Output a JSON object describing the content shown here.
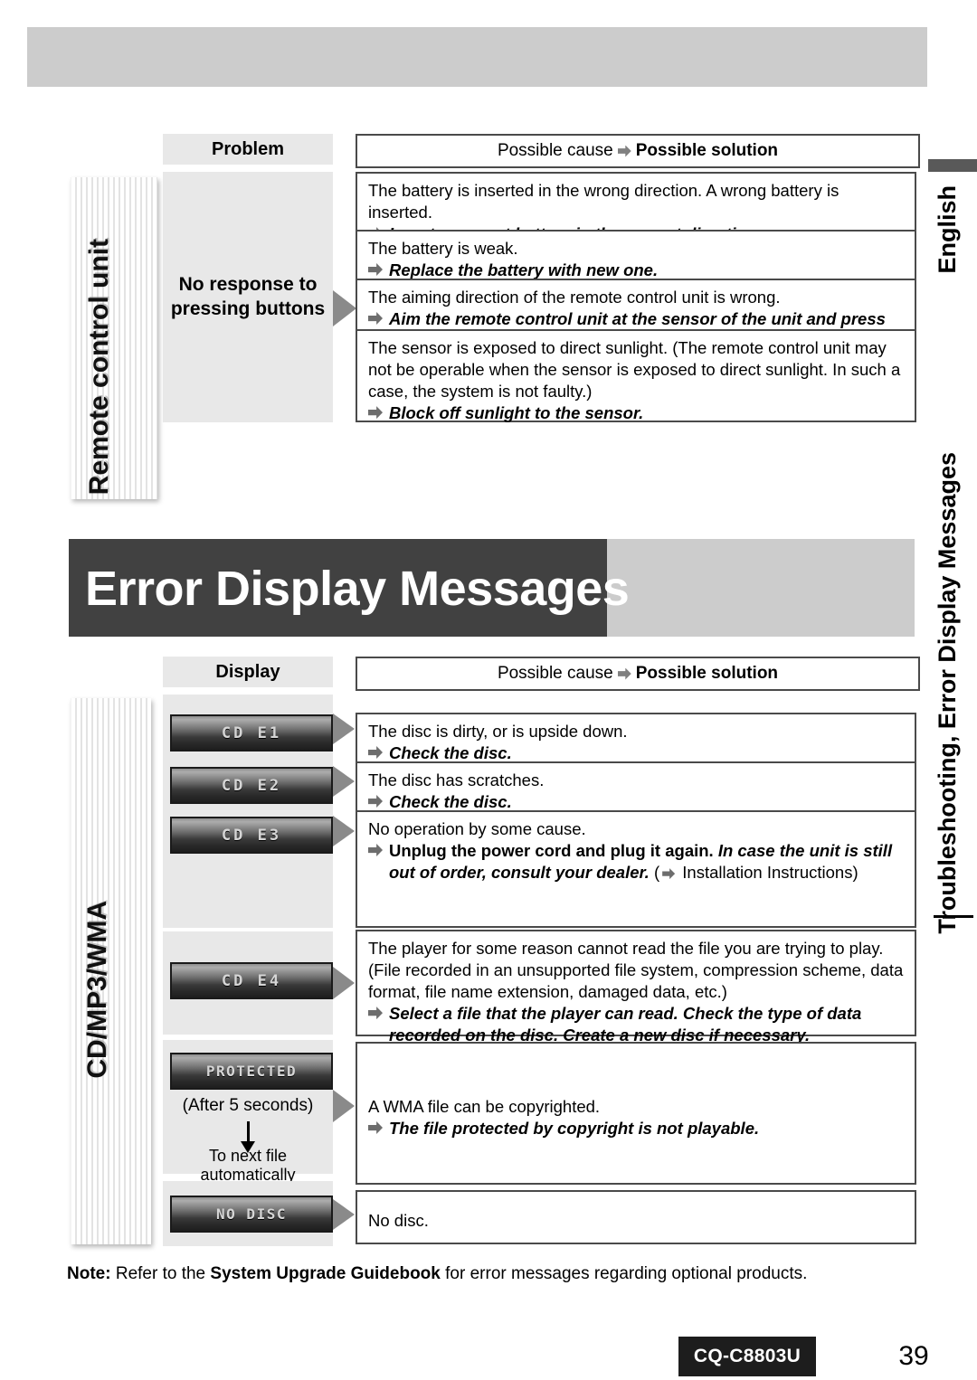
{
  "right_sidebar": {
    "language_tab": "English",
    "section_tab": "Troubleshooting, Error Display Messages"
  },
  "left_tabs": {
    "remote": "Remote control unit",
    "cd": "CD/MP3/WMA"
  },
  "banner": {
    "title": "Error Display Messages"
  },
  "troubleshooting_table": {
    "header_left": "Problem",
    "header_right_prefix": "Possible cause",
    "header_right_suffix": "Possible solution",
    "problem_label": "No response to\npressing buttons",
    "problem_label_line1": "No response to",
    "problem_label_line2": "pressing buttons",
    "rows": [
      {
        "cause": "The battery is inserted in the wrong direction. A wrong battery is inserted.",
        "solution": "Insert a correct battery in the correct direction."
      },
      {
        "cause": "The battery is weak.",
        "solution": "Replace the battery with new one."
      },
      {
        "cause": "The aiming direction of the remote control unit is wrong.",
        "solution": "Aim the remote control unit at the sensor of the unit and press buttons."
      },
      {
        "cause": "The sensor is exposed to direct sunlight. (The remote control unit may not be operable when the sensor is exposed to direct sunlight. In such a case, the system is not faulty.)",
        "solution": "Block off sunlight to the sensor."
      }
    ]
  },
  "error_table": {
    "header_left": "Display",
    "header_right_prefix": "Possible cause",
    "header_right_suffix": "Possible solution",
    "displays": {
      "cd_e1": "CD E1",
      "cd_e2": "CD E2",
      "cd_e3": "CD E3",
      "cd_e4": "CD E4",
      "protected": "PROTECTED",
      "no_disc": "NO DISC"
    },
    "protected_after": "(After 5 seconds)",
    "protected_next": "To next file automatically",
    "rows": [
      {
        "cause": "The disc is dirty, or is upside down.",
        "solution": "Check the disc."
      },
      {
        "cause": "The disc has scratches.",
        "solution": "Check the disc."
      },
      {
        "cause": "No operation by some cause.",
        "solution_bold_upright": "Unplug the power cord and plug it again.",
        "solution_italic": "In case the unit is still out of order, consult your dealer.",
        "solution_ref": "Installation Instructions"
      },
      {
        "cause": "The player for some reason cannot read the file you are trying to play. (File recorded in an unsupported file system, compression scheme, data format, file name extension, damaged data, etc.)",
        "solution": "Select a file that the player can read. Check the type of data recorded on the disc. Create a new disc if necessary."
      },
      {
        "cause": "A WMA file can be copyrighted.",
        "solution": "The file protected by copyright is not playable."
      },
      {
        "cause": "No disc.",
        "solution": ""
      }
    ]
  },
  "footer": {
    "note_label": "Note:",
    "note_text_1": "Refer to the",
    "note_bold": "System Upgrade Guidebook",
    "note_text_2": "for error messages regarding optional products.",
    "model": "CQ-C8803U",
    "page_number": "39"
  }
}
